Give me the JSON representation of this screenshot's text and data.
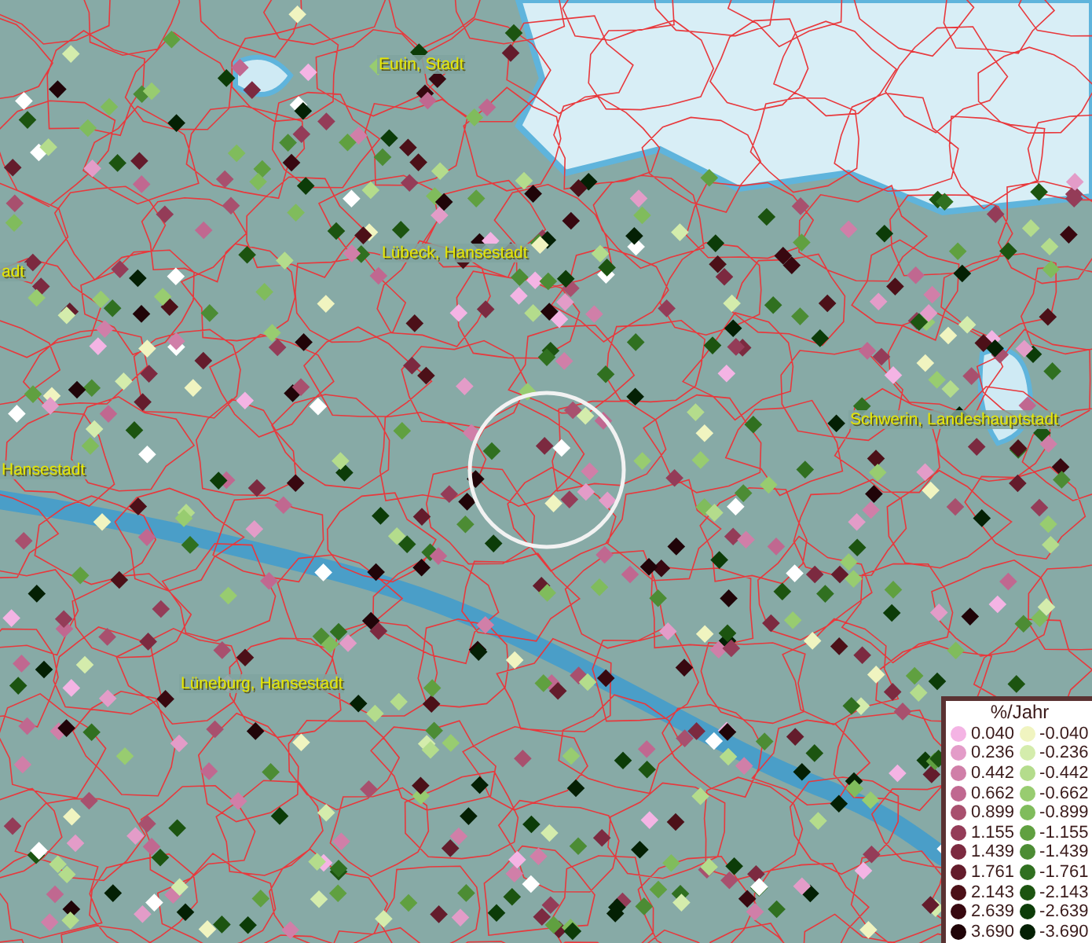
{
  "map": {
    "place_labels": [
      {
        "text": "Eutin, Stadt"
      },
      {
        "text": "Lübeck, Hansestadt"
      },
      {
        "text": "adt"
      },
      {
        "text": "Hansestadt"
      },
      {
        "text": "Schwerin, Landeshauptstadt"
      },
      {
        "text": "Lüneburg, Hansestadt"
      }
    ]
  },
  "legend": {
    "title": "%/Jahr",
    "columns": [
      [
        {
          "label": "0.040",
          "color": "#f4b4e4"
        },
        {
          "label": "0.236",
          "color": "#e39cc8"
        },
        {
          "label": "0.442",
          "color": "#d07fa8"
        },
        {
          "label": "0.662",
          "color": "#c06890"
        },
        {
          "label": "0.899",
          "color": "#a8506e"
        },
        {
          "label": "1.155",
          "color": "#943c58"
        },
        {
          "label": "1.439",
          "color": "#7c2a40"
        },
        {
          "label": "1.761",
          "color": "#641c2c"
        },
        {
          "label": "2.143",
          "color": "#4c1018"
        },
        {
          "label": "2.639",
          "color": "#380810"
        },
        {
          "label": "3.690",
          "color": "#200408"
        }
      ],
      [
        {
          "label": "-0.040",
          "color": "#f0f4c0"
        },
        {
          "label": "-0.236",
          "color": "#d4ecac"
        },
        {
          "label": "-0.442",
          "color": "#b4dc8c"
        },
        {
          "label": "-0.662",
          "color": "#98cc70"
        },
        {
          "label": "-0.899",
          "color": "#80bc5c"
        },
        {
          "label": "-1.155",
          "color": "#60a040"
        },
        {
          "label": "-1.439",
          "color": "#4c8c34"
        },
        {
          "label": "-1.761",
          "color": "#307020"
        },
        {
          "label": "-2.143",
          "color": "#1c5410"
        },
        {
          "label": "-2.639",
          "color": "#0c3c08"
        },
        {
          "label": "-3.690",
          "color": "#042004"
        }
      ]
    ]
  }
}
